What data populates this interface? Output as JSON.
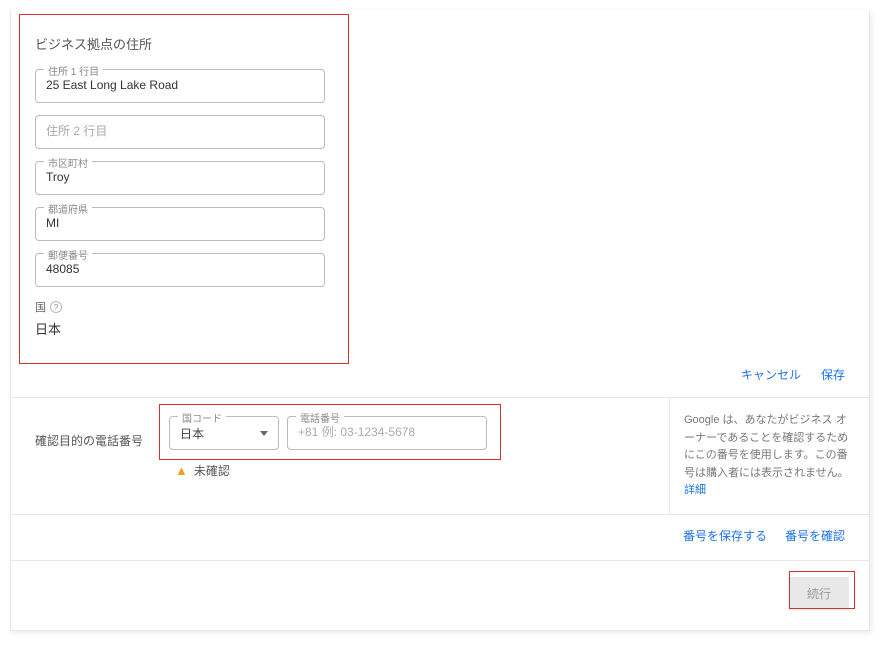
{
  "address": {
    "title": "ビジネス拠点の住所",
    "line1": {
      "label": "住所 1 行目",
      "value": "25 East Long Lake Road"
    },
    "line2": {
      "label": "住所 2 行目",
      "value": ""
    },
    "city": {
      "label": "市区町村",
      "value": "Troy"
    },
    "state": {
      "label": "都道府県",
      "value": "MI"
    },
    "postal": {
      "label": "郵便番号",
      "value": "48085"
    },
    "country_label": "国",
    "country_value": "日本"
  },
  "actions": {
    "cancel": "キャンセル",
    "save": "保存"
  },
  "phone": {
    "section_label": "確認目的の電話番号",
    "country_code_label": "国コード",
    "country_code_value": "日本",
    "number_label": "電話番号",
    "number_value": "",
    "number_placeholder": "+81 例: 03-1234-5678",
    "unverified": "未確認",
    "help_text": "Google は、あなたがビジネス オーナーであることを確認するためにこの番号を使用します。この番号は購入者には表示されません。",
    "details_link": "詳細",
    "save_number": "番号を保存する",
    "verify_number": "番号を確認"
  },
  "footer": {
    "continue": "続行"
  }
}
